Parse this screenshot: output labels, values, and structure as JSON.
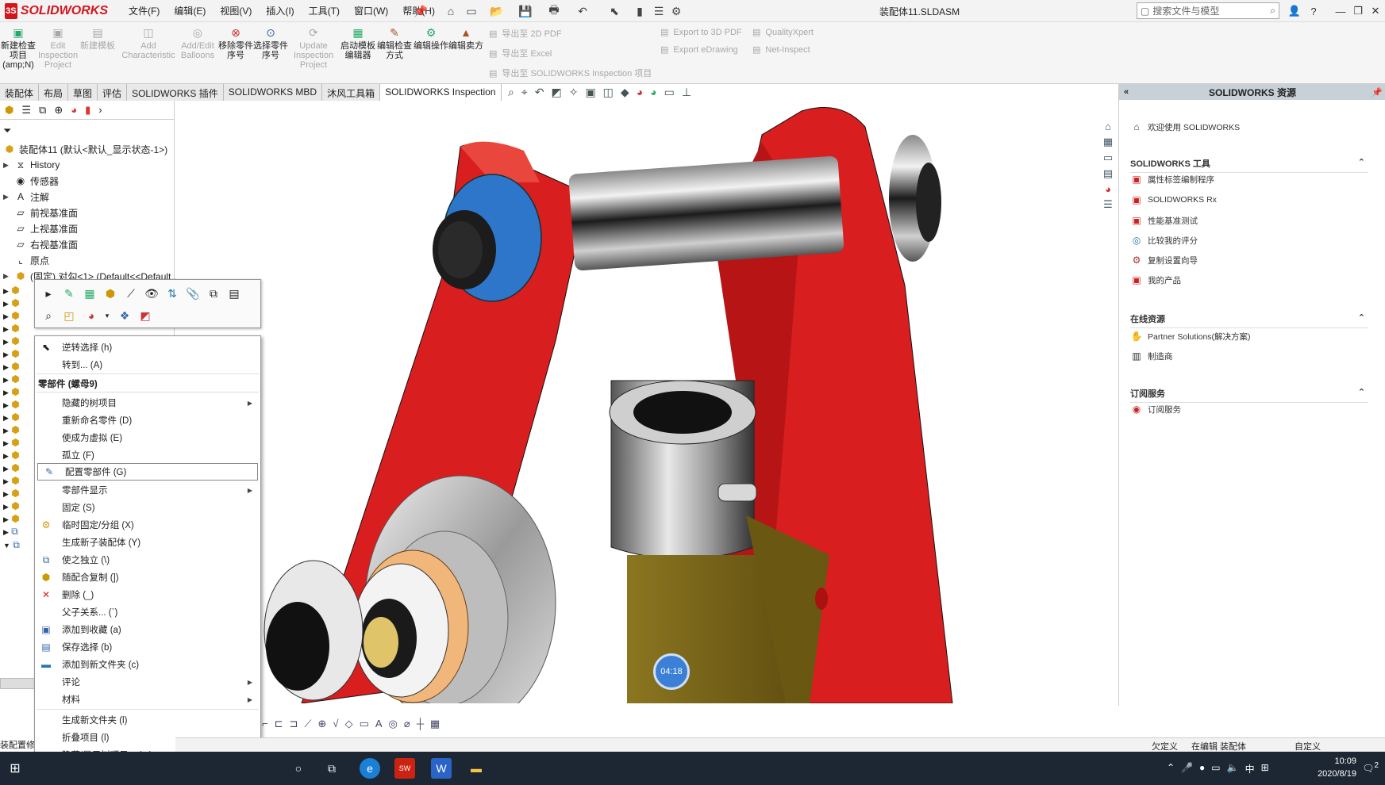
{
  "title_bar": {
    "brand": "SOLIDWORKS",
    "brand_badge": "3S",
    "document_title": "装配体11.SLDASM",
    "search_placeholder": "搜索文件与模型",
    "menus": [
      "文件(F)",
      "编辑(E)",
      "视图(V)",
      "插入(I)",
      "工具(T)",
      "窗口(W)",
      "帮助(H)"
    ]
  },
  "command_manager": {
    "buttons": [
      {
        "label": "新建检查项目(amp;N)",
        "enabled": true
      },
      {
        "label": "Edit Inspection Project",
        "enabled": false
      },
      {
        "label": "新建模板",
        "enabled": false
      },
      {
        "label": "Add Characteristic",
        "enabled": false
      },
      {
        "label": "Add/Edit Balloons",
        "enabled": false
      },
      {
        "label": "移除零件序号",
        "enabled": true
      },
      {
        "label": "选择零件序号",
        "enabled": true
      },
      {
        "label": "Update Inspection Project",
        "enabled": false
      },
      {
        "label": "启动模板编辑器",
        "enabled": true
      },
      {
        "label": "编辑检查方式",
        "enabled": true
      },
      {
        "label": "编辑操作",
        "enabled": true
      },
      {
        "label": "编辑卖方",
        "enabled": true
      }
    ],
    "export_items": [
      "导出至 2D PDF",
      "导出至 Excel",
      "导出至 SOLIDWORKS Inspection 项目"
    ],
    "export_items_en": [
      "Export to 3D PDF",
      "Export eDrawing"
    ],
    "quality_items": [
      "QualityXpert",
      "Net-Inspect"
    ]
  },
  "tabs": [
    {
      "label": "装配体",
      "active": false
    },
    {
      "label": "布局",
      "active": false
    },
    {
      "label": "草图",
      "active": false
    },
    {
      "label": "评估",
      "active": false
    },
    {
      "label": "SOLIDWORKS 插件",
      "active": false
    },
    {
      "label": "SOLIDWORKS MBD",
      "active": false
    },
    {
      "label": "沐风工具箱",
      "active": false
    },
    {
      "label": "SOLIDWORKS Inspection",
      "active": true
    }
  ],
  "feature_tree": {
    "root": "装配体11 (默认<默认_显示状态-1>)",
    "nodes": [
      "History",
      "传感器",
      "注解",
      "前视基准面",
      "上视基准面",
      "右视基准面",
      "原点",
      "(固定) 对勾<1> (Default<<Default..."
    ]
  },
  "context_menu": {
    "items": [
      {
        "label": "逆转选择 (h)",
        "icon": "cursor-icon",
        "type": "item"
      },
      {
        "label": "转到... (A)",
        "icon": "",
        "type": "item"
      },
      {
        "label": "零部件 (螺母9)",
        "type": "header"
      },
      {
        "label": "隐藏的树项目",
        "icon": "",
        "type": "submenu"
      },
      {
        "label": "重新命名零件 (D)",
        "icon": "",
        "type": "item"
      },
      {
        "label": "使成为虚拟 (E)",
        "icon": "",
        "type": "item"
      },
      {
        "label": "孤立 (F)",
        "icon": "",
        "type": "item"
      },
      {
        "label": "配置零部件 (G)",
        "icon": "pencil-icon",
        "type": "highlight"
      },
      {
        "label": "零部件显示",
        "icon": "",
        "type": "submenu"
      },
      {
        "label": "固定 (S)",
        "icon": "",
        "type": "item"
      },
      {
        "label": "临时固定/分组 (X)",
        "icon": "gears-icon",
        "type": "item"
      },
      {
        "label": "生成新子装配体 (Y)",
        "icon": "",
        "type": "item"
      },
      {
        "label": "使之独立 (\\)",
        "icon": "independent-icon",
        "type": "item"
      },
      {
        "label": "随配合复制 (])",
        "icon": "copy-mates-icon",
        "type": "item"
      },
      {
        "label": "删除 (_)",
        "icon": "delete-icon",
        "type": "item"
      },
      {
        "label": "父子关系... (`)",
        "icon": "",
        "type": "item"
      },
      {
        "label": "添加到收藏 (a)",
        "icon": "favorite-icon",
        "type": "item"
      },
      {
        "label": "保存选择 (b)",
        "icon": "save-selection-icon",
        "type": "item"
      },
      {
        "label": "添加到新文件夹 (c)",
        "icon": "folder-icon",
        "type": "item"
      },
      {
        "label": "评论",
        "icon": "",
        "type": "submenu"
      },
      {
        "label": "材料",
        "icon": "",
        "type": "submenu"
      },
      {
        "label": "生成新文件夹 (l)",
        "icon": "",
        "type": "item"
      },
      {
        "label": "折叠项目 (l)",
        "icon": "",
        "type": "item"
      },
      {
        "label": "隐藏/显示树项目... (m)",
        "icon": "",
        "type": "item"
      }
    ]
  },
  "task_pane": {
    "title": "SOLIDWORKS 资源",
    "welcome": "欢迎使用 SOLIDWORKS",
    "tools_title": "SOLIDWORKS 工具",
    "tools": [
      "属性标签编制程序",
      "SOLIDWORKS Rx",
      "性能基准测试",
      "比较我的评分",
      "复制设置向导",
      "我的产品"
    ],
    "online_title": "在线资源",
    "online": [
      "Partner Solutions(解决方案)",
      "制造商"
    ],
    "subscription_title": "订阅服务",
    "subscription": [
      "订阅服务"
    ]
  },
  "status_bar": {
    "left": "装配置修",
    "underdefined": "欠定义",
    "editing": "在编辑 装配体",
    "custom": "自定义"
  },
  "timer": "04:18",
  "taskbar": {
    "time": "10:09",
    "date": "2020/8/19",
    "ime": "中",
    "notification_count": "2"
  },
  "colors": {
    "brand": "#d4161c",
    "part_red": "#d81e1e",
    "part_blue": "#2e76c9",
    "taskbar": "#1d2733"
  }
}
